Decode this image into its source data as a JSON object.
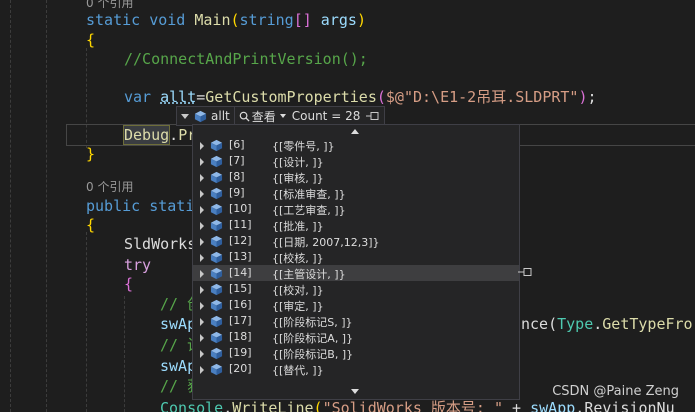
{
  "editor": {
    "codelens_top": "0 个引用",
    "codelens_mid": "0 个引用",
    "line_main": {
      "kw1": "static",
      "kw2": "void",
      "name": "Main",
      "paren_open": "(",
      "type": "string",
      "brk": "[]",
      "arg": " args",
      "paren_close": ")"
    },
    "open_brace_1": "{",
    "comment_connect": "//ConnectAndPrintVersion();",
    "line_var": {
      "kw": "var",
      "name": "allt",
      "eq": "=",
      "fn": "GetCustomProperties",
      "po": "(",
      "str": "$@\"D:\\E1-2吊耳.SLDPRT\"",
      "pc": ")",
      "semi": ";"
    },
    "line_debug": {
      "cls": "Debug",
      "dot": ".",
      "partial": "Pr"
    },
    "close_brace_1": "}",
    "line_public": {
      "kw1": "public",
      "kw2": "stati"
    },
    "open_brace_2": "{",
    "line_sldworks": "SldWorks",
    "line_try": "try",
    "open_brace_3": "{",
    "line_c1": "// 创",
    "line_swap1": {
      "name": "swAp",
      "tail1": "nce(",
      "type": "Type",
      "dot": ".",
      "tail2": "GetTypeFro"
    },
    "line_c2": "// 设",
    "line_swap2": "swAp",
    "line_c3": "// 获",
    "line_console": {
      "cls": "Console",
      "dot": ".",
      "fn": "WriteLine",
      "po": "(",
      "str": "\"SolidWorks 版本号: \"",
      "plus": " + ",
      "obj": "swApp",
      "dot2": ".",
      "prop": "RevisionNu"
    }
  },
  "datatip": {
    "variable": "allt",
    "view_label": "查看",
    "count_label": "Count = 28",
    "items": [
      {
        "index": "[6]",
        "value": "{[零件号, ]}"
      },
      {
        "index": "[7]",
        "value": "{[设计,  ]}"
      },
      {
        "index": "[8]",
        "value": "{[审核, ]}"
      },
      {
        "index": "[9]",
        "value": "{[标准审查, ]}"
      },
      {
        "index": "[10]",
        "value": "{[工艺审查, ]}"
      },
      {
        "index": "[11]",
        "value": "{[批准, ]}"
      },
      {
        "index": "[12]",
        "value": "{[日期, 2007,12,3]}"
      },
      {
        "index": "[13]",
        "value": "{[校核, ]}"
      },
      {
        "index": "[14]",
        "value": "{[主管设计, ]}"
      },
      {
        "index": "[15]",
        "value": "{[校对, ]}"
      },
      {
        "index": "[16]",
        "value": "{[审定, ]}"
      },
      {
        "index": "[17]",
        "value": "{[阶段标记S, ]}"
      },
      {
        "index": "[18]",
        "value": "{[阶段标记A, ]}"
      },
      {
        "index": "[19]",
        "value": "{[阶段标记B, ]}"
      },
      {
        "index": "[20]",
        "value": "{[替代, ]}"
      }
    ],
    "hover_index": 8
  },
  "watermark": "CSDN @Paine Zeng",
  "colors": {
    "background": "#1e1e1e",
    "keyword": "#569cd6",
    "function": "#dcdcaa",
    "type": "#4ec9b0",
    "comment": "#57a64a",
    "string": "#d69d85",
    "tip_bg": "#252526"
  }
}
